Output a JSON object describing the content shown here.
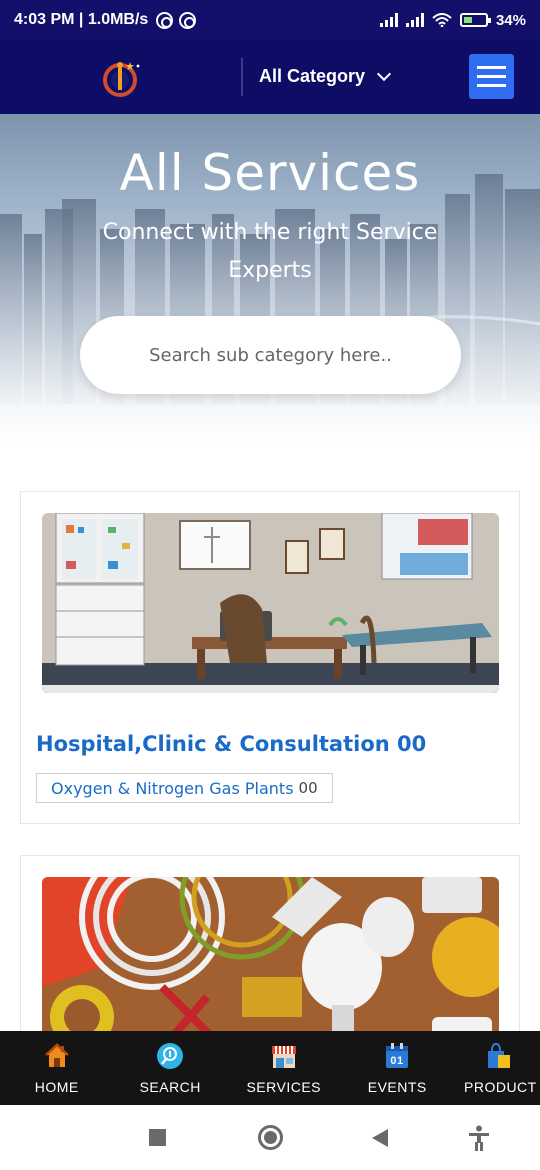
{
  "status_bar": {
    "time": "4:03 PM",
    "speed": "1.0MB/s",
    "battery": "34%",
    "icons": [
      "sync-icon",
      "sync-icon",
      "signal-icon",
      "signal-icon",
      "wifi-icon",
      "battery-charging-icon"
    ]
  },
  "header": {
    "logo_icon": "brand-logo",
    "category_label": "All Category",
    "menu_icon": "hamburger-icon",
    "accent_color": "#2f6ef2",
    "bg_color": "#0d0d66"
  },
  "hero": {
    "title": "All Services",
    "subtitle": "Connect with the right Service Experts",
    "search_placeholder": "Search sub category here.."
  },
  "cards": [
    {
      "image": "hospital-office-illustration",
      "title": "Hospital,Clinic & Consultation 00",
      "chips": [
        {
          "label": "Oxygen & Nitrogen Gas Plants",
          "count": "00"
        }
      ]
    },
    {
      "image": "electrical-supplies-photo",
      "title": "",
      "chips": []
    }
  ],
  "bottom_nav": [
    {
      "label": "HOME",
      "icon": "home-icon"
    },
    {
      "label": "SEARCH",
      "icon": "search-icon"
    },
    {
      "label": "SERVICES",
      "icon": "store-icon"
    },
    {
      "label": "EVENTS",
      "icon": "calendar-icon",
      "icon_text": "01"
    },
    {
      "label": "PRODUCT",
      "icon": "shopping-bag-icon"
    }
  ],
  "system_nav": [
    "recents-icon",
    "home-circle-icon",
    "back-icon",
    "accessibility-icon"
  ]
}
